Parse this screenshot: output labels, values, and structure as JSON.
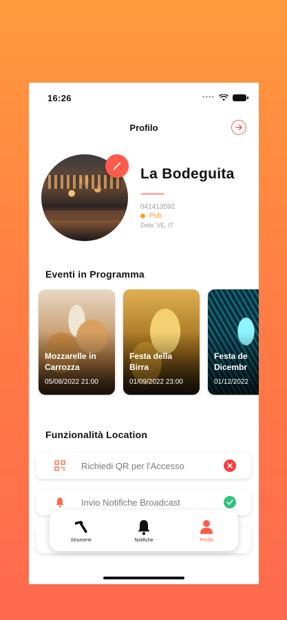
{
  "status_bar": {
    "time": "16:26"
  },
  "header": {
    "title": "Profilo"
  },
  "profile": {
    "name": "La Bodeguita",
    "phone": "041413592",
    "type": "Pub",
    "address": "Dolo, VE, IT"
  },
  "events": {
    "title": "Eventi in Programma",
    "items": [
      {
        "name_line1": "Mozzarelle in",
        "name_line2": "Carrozza",
        "date": "05/08/2022 21:00"
      },
      {
        "name_line1": "Festa della",
        "name_line2": "Birra",
        "date": "01/09/2022 23:00"
      },
      {
        "name_line1": "Festa de",
        "name_line2": "Dicembr",
        "date": "01/12/2022"
      }
    ]
  },
  "features": {
    "title": "Funzionalità Location",
    "items": [
      {
        "label": "Richiedi QR per l'Accesso",
        "enabled": false,
        "icon": "qr-code-icon"
      },
      {
        "label": "Invio Notifiche Broadcast",
        "enabled": true,
        "icon": "bell-icon"
      }
    ]
  },
  "tabbar": {
    "items": [
      {
        "label": "Strumenti",
        "icon": "hammer-icon"
      },
      {
        "label": "Notifiche",
        "icon": "bell-icon"
      },
      {
        "label": "Profilo",
        "icon": "user-icon",
        "active": true
      }
    ]
  },
  "colors": {
    "accent": "#ff5b4a",
    "pub_orange": "#ff9c2a",
    "disabled_red": "#ff3b3b",
    "enabled_green": "#2ec27e"
  }
}
